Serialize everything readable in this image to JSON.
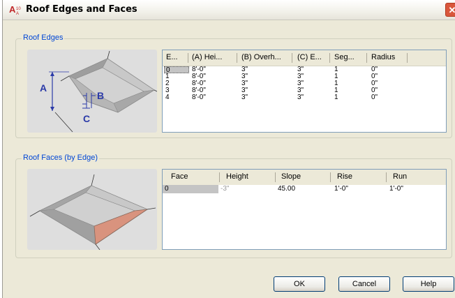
{
  "window": {
    "title": "Roof Edges and Faces",
    "close_glyph": "✕"
  },
  "edges": {
    "group_label": "Roof Edges",
    "diagram_labels": {
      "a": "A",
      "b": "B",
      "c": "C"
    },
    "columns": [
      "E...",
      "(A) Hei...",
      "(B) Overh...",
      "(C) E...",
      "Seg...",
      "Radius"
    ],
    "rows": [
      [
        "0",
        "8'-0\"",
        "3\"",
        "3\"",
        "1",
        "0\""
      ],
      [
        "1",
        "8'-0\"",
        "3\"",
        "3\"",
        "1",
        "0\""
      ],
      [
        "2",
        "8'-0\"",
        "3\"",
        "3\"",
        "1",
        "0\""
      ],
      [
        "3",
        "8'-0\"",
        "3\"",
        "3\"",
        "1",
        "0\""
      ],
      [
        "4",
        "8'-0\"",
        "3\"",
        "3\"",
        "1",
        "0\""
      ]
    ]
  },
  "faces": {
    "group_label": "Roof Faces (by Edge)",
    "columns": [
      "Face",
      "Height",
      "Slope",
      "Rise",
      "Run"
    ],
    "rows": [
      [
        "0",
        "-3\"",
        "45.00",
        "1'-0\"",
        "1'-0\""
      ]
    ]
  },
  "buttons": {
    "ok": "OK",
    "cancel": "Cancel",
    "help": "Help"
  },
  "colors": {
    "group_label": "#0046d5",
    "face_fill": "#d9937e",
    "selection": "#c4c4c4"
  }
}
